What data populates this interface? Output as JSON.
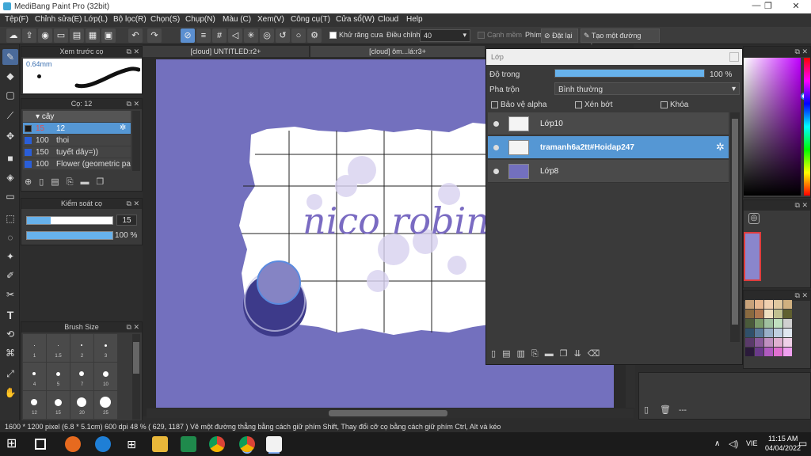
{
  "window": {
    "title": "MediBang Paint Pro (32bit)",
    "minimize": "—",
    "restore": "❐",
    "close": "✕"
  },
  "menu": [
    "Tệp(F)",
    "Chỉnh sửa(E)",
    "Lớp(L)",
    "Bộ lọc(R)",
    "Chọn(S)",
    "Chụp(N)",
    "Màu (C)",
    "Xem(V)",
    "Công cụ(T)",
    "Cửa sổ(W)",
    "Cloud",
    "Help"
  ],
  "toolbar": {
    "antialias_label": "Khử răng cưa",
    "adjust_label": "Điều chỉnh",
    "adjust_value": "40",
    "edge_label": "Cạnh mềm",
    "key_label": "Phím",
    "reset_label": "Đặt lại",
    "line_label": "Tạo một đường thẳng"
  },
  "preview": {
    "title": "Xem trước cọ",
    "size": "0.64mm"
  },
  "brush": {
    "title": "Cọ: 12",
    "group": "cây",
    "items": [
      {
        "size": "15",
        "name": "12"
      },
      {
        "size": "100",
        "name": "thoi"
      },
      {
        "size": "150",
        "name": "tuyết dây=))"
      },
      {
        "size": "100",
        "name": "Flower (geometric patt"
      }
    ]
  },
  "brush_control": {
    "title": "Kiểm soát cọ",
    "size_value": "15",
    "opacity_value": "100 %",
    "size_fill": 0.28,
    "opacity_fill": 1.0
  },
  "brush_size": {
    "title": "Brush Size",
    "labels": [
      "1",
      "1.5",
      "2",
      "3",
      "4",
      "5",
      "7",
      "10",
      "12",
      "15",
      "20",
      "25"
    ]
  },
  "tabs": [
    "[cloud] UNTITLED:r2+",
    "[cloud] ôm...lá:r3+"
  ],
  "canvas": {
    "text": "nico robin",
    "bg": "#7370be"
  },
  "layers": {
    "title": "Lớp",
    "opacity_label": "Độ trong",
    "opacity_value": "100 %",
    "blend_label": "Pha trộn",
    "blend_value": "Bình thường",
    "protect_alpha": "Bảo vệ alpha",
    "clip": "Xén bớt",
    "lock": "Khóa",
    "items": [
      {
        "name": "Lớp10",
        "selected": false
      },
      {
        "name": "tramanh6a2tt#Hoidap247",
        "selected": true
      },
      {
        "name": "Lớp8",
        "selected": false
      }
    ]
  },
  "right_panel": {
    "footer": "---"
  },
  "status": {
    "text": "1600 * 1200 pixel  (6.8 * 5.1cm)  600 dpi  48 %  ( 629, 1187 )  Vẽ một đường thẳng bằng cách giữ phím Shift, Thay đổi cỡ cọ bằng cách giữ phím Ctrl, Alt và kéo"
  },
  "taskbar": {
    "lang": "VIE",
    "time": "11:15 AM",
    "date": "04/04/2022"
  }
}
